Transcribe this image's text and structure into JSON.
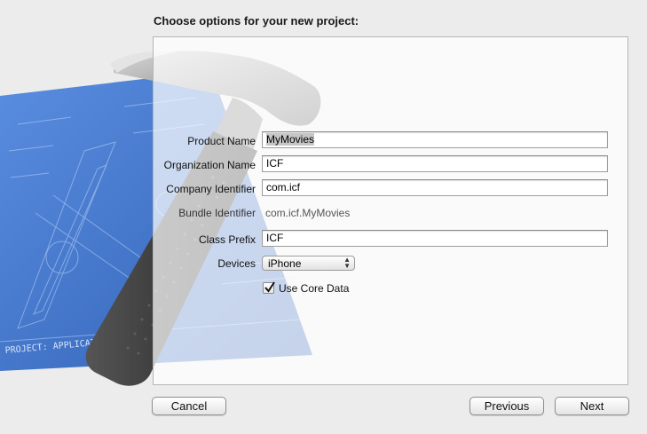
{
  "dialog": {
    "title": "Choose options for your new project:"
  },
  "form": {
    "product_name": {
      "label": "Product Name",
      "value": "MyMovies"
    },
    "organization_name": {
      "label": "Organization Name",
      "value": "ICF"
    },
    "company_identifier": {
      "label": "Company Identifier",
      "value": "com.icf"
    },
    "bundle_identifier": {
      "label": "Bundle Identifier",
      "value": "com.icf.MyMovies"
    },
    "class_prefix": {
      "label": "Class Prefix",
      "value": "ICF"
    },
    "devices": {
      "label": "Devices",
      "selected": "iPhone"
    },
    "use_core_data": {
      "label": "Use Core Data",
      "checked": true
    }
  },
  "buttons": {
    "cancel": "Cancel",
    "previous": "Previous",
    "next": "Next"
  },
  "blueprint": {
    "footer_text": "PROJECT: APPLICATION.APP"
  },
  "colors": {
    "blueprint": "#3f74c8",
    "hammer_head": "#9a9a9a",
    "hammer_grip": "#3b3b3b"
  }
}
